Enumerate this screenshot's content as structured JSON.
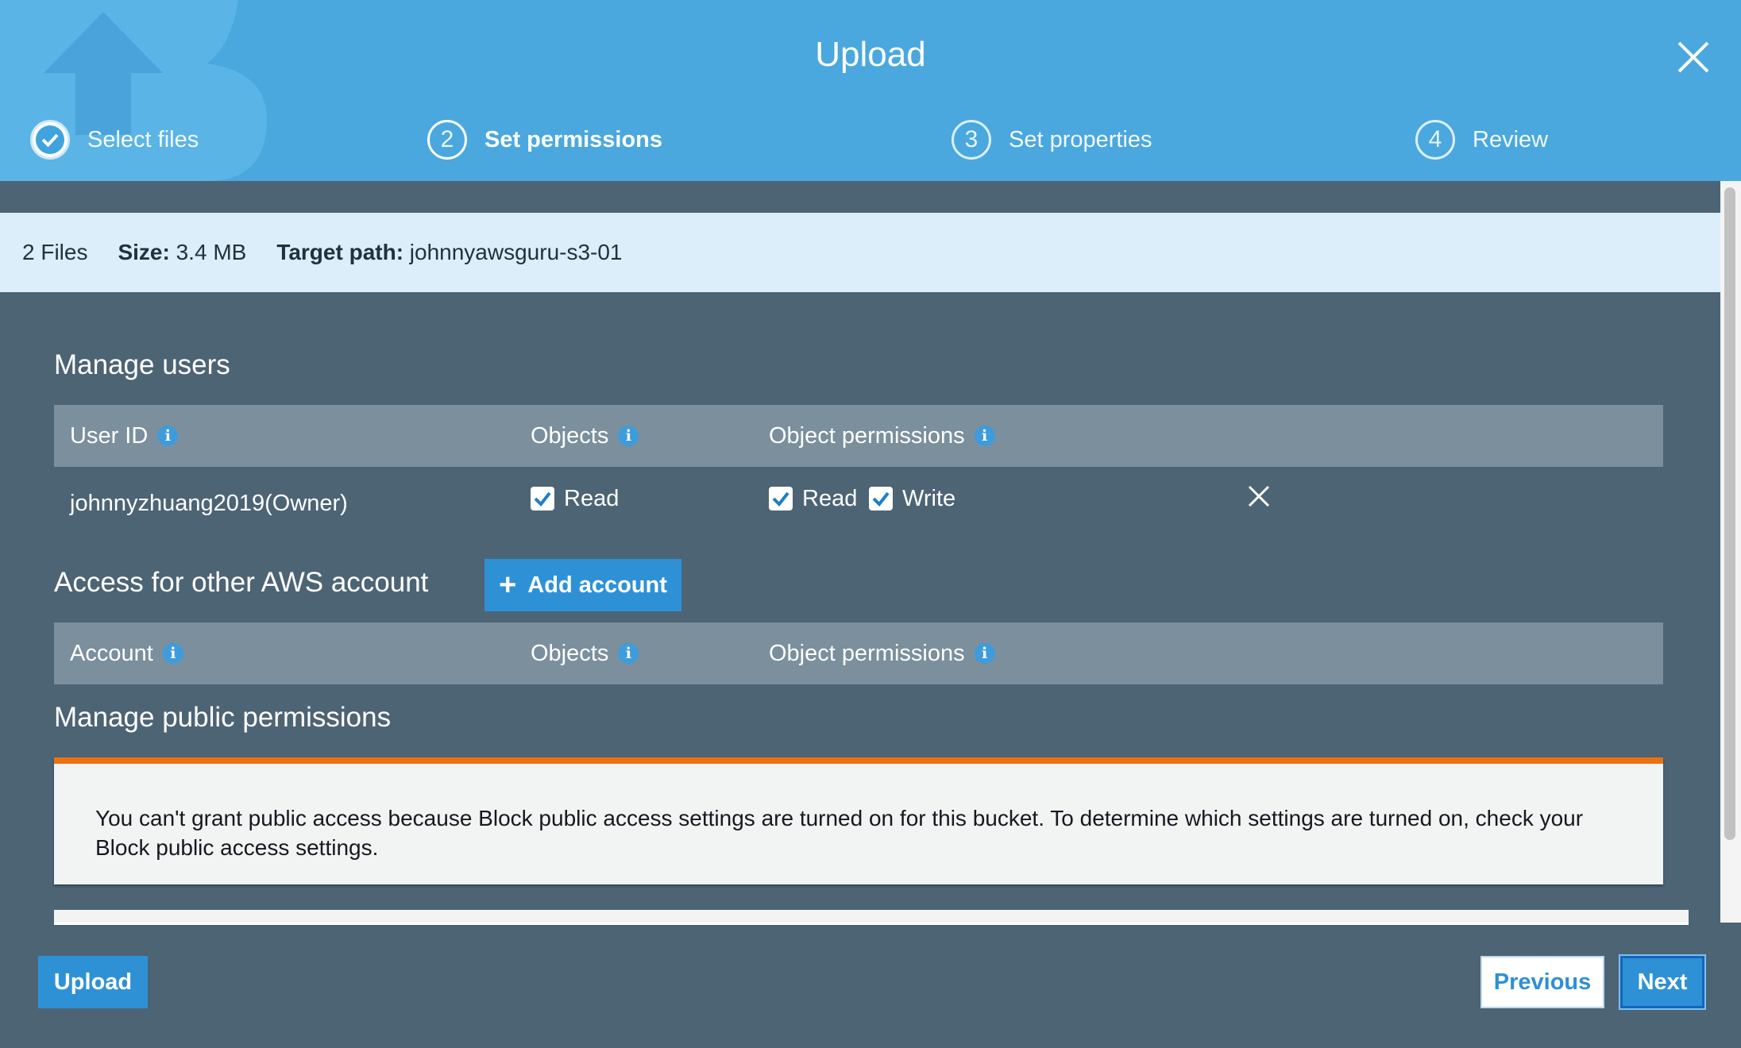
{
  "header": {
    "title": "Upload",
    "steps": [
      {
        "number": "1",
        "label": "Select files",
        "state": "done"
      },
      {
        "number": "2",
        "label": "Set permissions",
        "state": "active"
      },
      {
        "number": "3",
        "label": "Set properties",
        "state": "pending"
      },
      {
        "number": "4",
        "label": "Review",
        "state": "pending"
      }
    ]
  },
  "summary": {
    "files": "2 Files",
    "size_label": "Size:",
    "size_value": "3.4 MB",
    "target_label": "Target path:",
    "target_value": "johnnyawsguru-s3-01"
  },
  "manage_users": {
    "title": "Manage users",
    "columns": {
      "user_id": "User ID",
      "objects": "Objects",
      "object_permissions": "Object permissions"
    },
    "rows": [
      {
        "user": "johnnyzhuang2019(Owner)",
        "objects_read": {
          "label": "Read",
          "checked": true
        },
        "perm_read": {
          "label": "Read",
          "checked": true
        },
        "perm_write": {
          "label": "Write",
          "checked": true
        }
      }
    ]
  },
  "other_accounts": {
    "title": "Access for other AWS account",
    "add_button": "Add account",
    "columns": {
      "account": "Account",
      "objects": "Objects",
      "object_permissions": "Object permissions"
    }
  },
  "public_permissions": {
    "title": "Manage public permissions",
    "warning_line1": "You can't grant public access because Block public access settings are turned on for this bucket. To determine which settings are turned on, check your",
    "warning_line2": "Block public access settings."
  },
  "footer": {
    "upload": "Upload",
    "previous": "Previous",
    "next": "Next"
  },
  "icons": {
    "info": "info-icon",
    "close": "close-icon",
    "remove": "remove-icon",
    "check": "checkmark-icon",
    "plus": "plus-icon"
  },
  "colors": {
    "header_bg": "#4aa8df",
    "body_bg": "#4d6475",
    "accent": "#2e91d6",
    "warning": "#ec7211"
  }
}
